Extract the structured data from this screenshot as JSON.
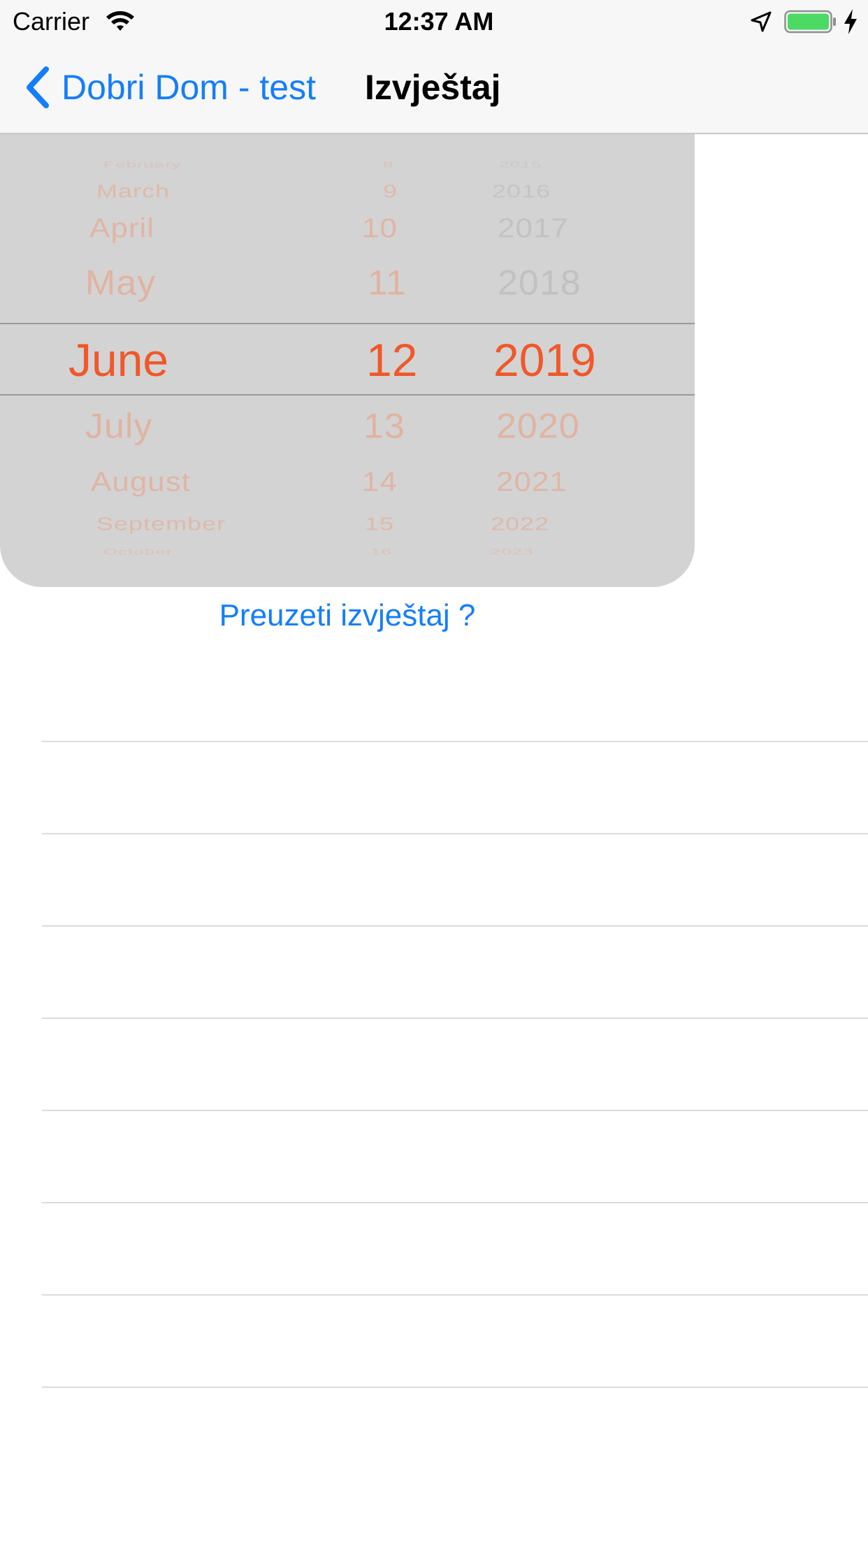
{
  "status_bar": {
    "carrier": "Carrier",
    "time": "12:37 AM",
    "battery_color": "#4cd964"
  },
  "nav": {
    "back_label": "Dobri Dom - test",
    "title": "Izvještaj"
  },
  "date_picker": {
    "months": [
      "February",
      "March",
      "April",
      "May",
      "June",
      "July",
      "August",
      "September",
      "October"
    ],
    "days": [
      "8",
      "9",
      "10",
      "11",
      "12",
      "13",
      "14",
      "15",
      "16"
    ],
    "years": [
      "2015",
      "2016",
      "2017",
      "2018",
      "2019",
      "2020",
      "2021",
      "2022",
      "2023"
    ],
    "selected": {
      "month": "June",
      "day": "12",
      "year": "2019"
    },
    "accent_color": "#f0582a"
  },
  "download_link": "Preuzeti izvještaj ?",
  "table": {
    "row_count_visible": 8
  }
}
